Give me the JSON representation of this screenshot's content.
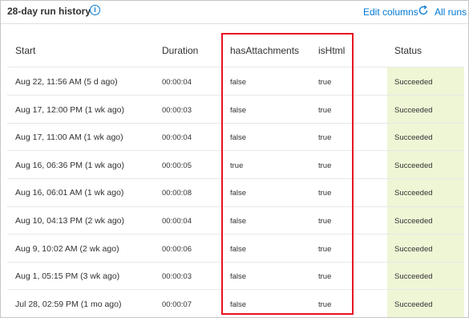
{
  "header": {
    "title": "28-day run history",
    "info_icon": "info-icon",
    "edit_columns": "Edit columns",
    "refresh_icon": "refresh-icon",
    "all_runs": "All runs"
  },
  "columns": {
    "start": "Start",
    "duration": "Duration",
    "has_attachments": "hasAttachments",
    "is_html": "isHtml",
    "status": "Status"
  },
  "rows": [
    {
      "start": "Aug 22, 11:56 AM (5 d ago)",
      "duration": "00:00:04",
      "has_attachments": "false",
      "is_html": "true",
      "status": "Succeeded"
    },
    {
      "start": "Aug 17, 12:00 PM (1 wk ago)",
      "duration": "00:00:03",
      "has_attachments": "false",
      "is_html": "true",
      "status": "Succeeded"
    },
    {
      "start": "Aug 17, 11:00 AM (1 wk ago)",
      "duration": "00:00:04",
      "has_attachments": "false",
      "is_html": "true",
      "status": "Succeeded"
    },
    {
      "start": "Aug 16, 06:36 PM (1 wk ago)",
      "duration": "00:00:05",
      "has_attachments": "true",
      "is_html": "true",
      "status": "Succeeded"
    },
    {
      "start": "Aug 16, 06:01 AM (1 wk ago)",
      "duration": "00:00:08",
      "has_attachments": "false",
      "is_html": "true",
      "status": "Succeeded"
    },
    {
      "start": "Aug 10, 04:13 PM (2 wk ago)",
      "duration": "00:00:04",
      "has_attachments": "false",
      "is_html": "true",
      "status": "Succeeded"
    },
    {
      "start": "Aug 9, 10:02 AM (2 wk ago)",
      "duration": "00:00:06",
      "has_attachments": "false",
      "is_html": "true",
      "status": "Succeeded"
    },
    {
      "start": "Aug 1, 05:15 PM (3 wk ago)",
      "duration": "00:00:03",
      "has_attachments": "false",
      "is_html": "true",
      "status": "Succeeded"
    },
    {
      "start": "Jul 28, 02:59 PM (1 mo ago)",
      "duration": "00:00:07",
      "has_attachments": "false",
      "is_html": "true",
      "status": "Succeeded"
    }
  ],
  "colors": {
    "accent": "#0078d4",
    "success_bg": "#eef6d6",
    "highlight_border": "#e81123"
  }
}
